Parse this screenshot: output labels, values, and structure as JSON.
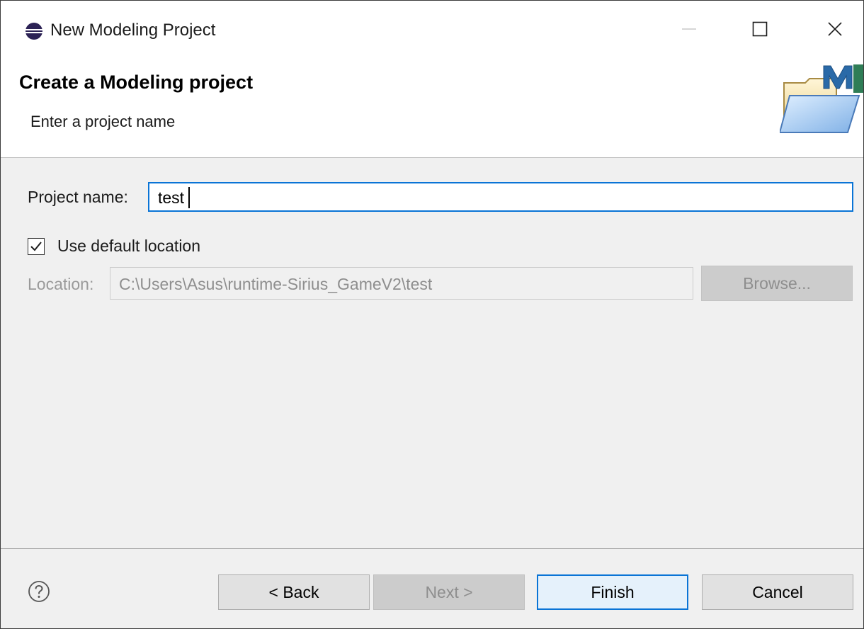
{
  "window": {
    "title": "New Modeling Project",
    "app_icon": "eclipse-icon",
    "controls": [
      "minimize-icon",
      "maximize-icon",
      "close-icon"
    ]
  },
  "banner": {
    "title": "Create a Modeling project",
    "subtitle": "Enter a project name",
    "image": "modeling-project-folder-icon"
  },
  "form": {
    "project_name_label": "Project name:",
    "project_name_value": "test",
    "use_default_location_label": "Use default location",
    "use_default_location_checked": true,
    "location_label": "Location:",
    "location_value": "C:\\Users\\Asus\\runtime-Sirius_GameV2\\test",
    "browse_label": "Browse..."
  },
  "footer": {
    "help_icon": "help-icon",
    "back_label": "< Back",
    "next_label": "Next >",
    "finish_label": "Finish",
    "cancel_label": "Cancel"
  },
  "colors": {
    "accent": "#0a74d6",
    "dialog_bg": "#f0f0f0",
    "disabled_text": "#8e8e8e"
  }
}
